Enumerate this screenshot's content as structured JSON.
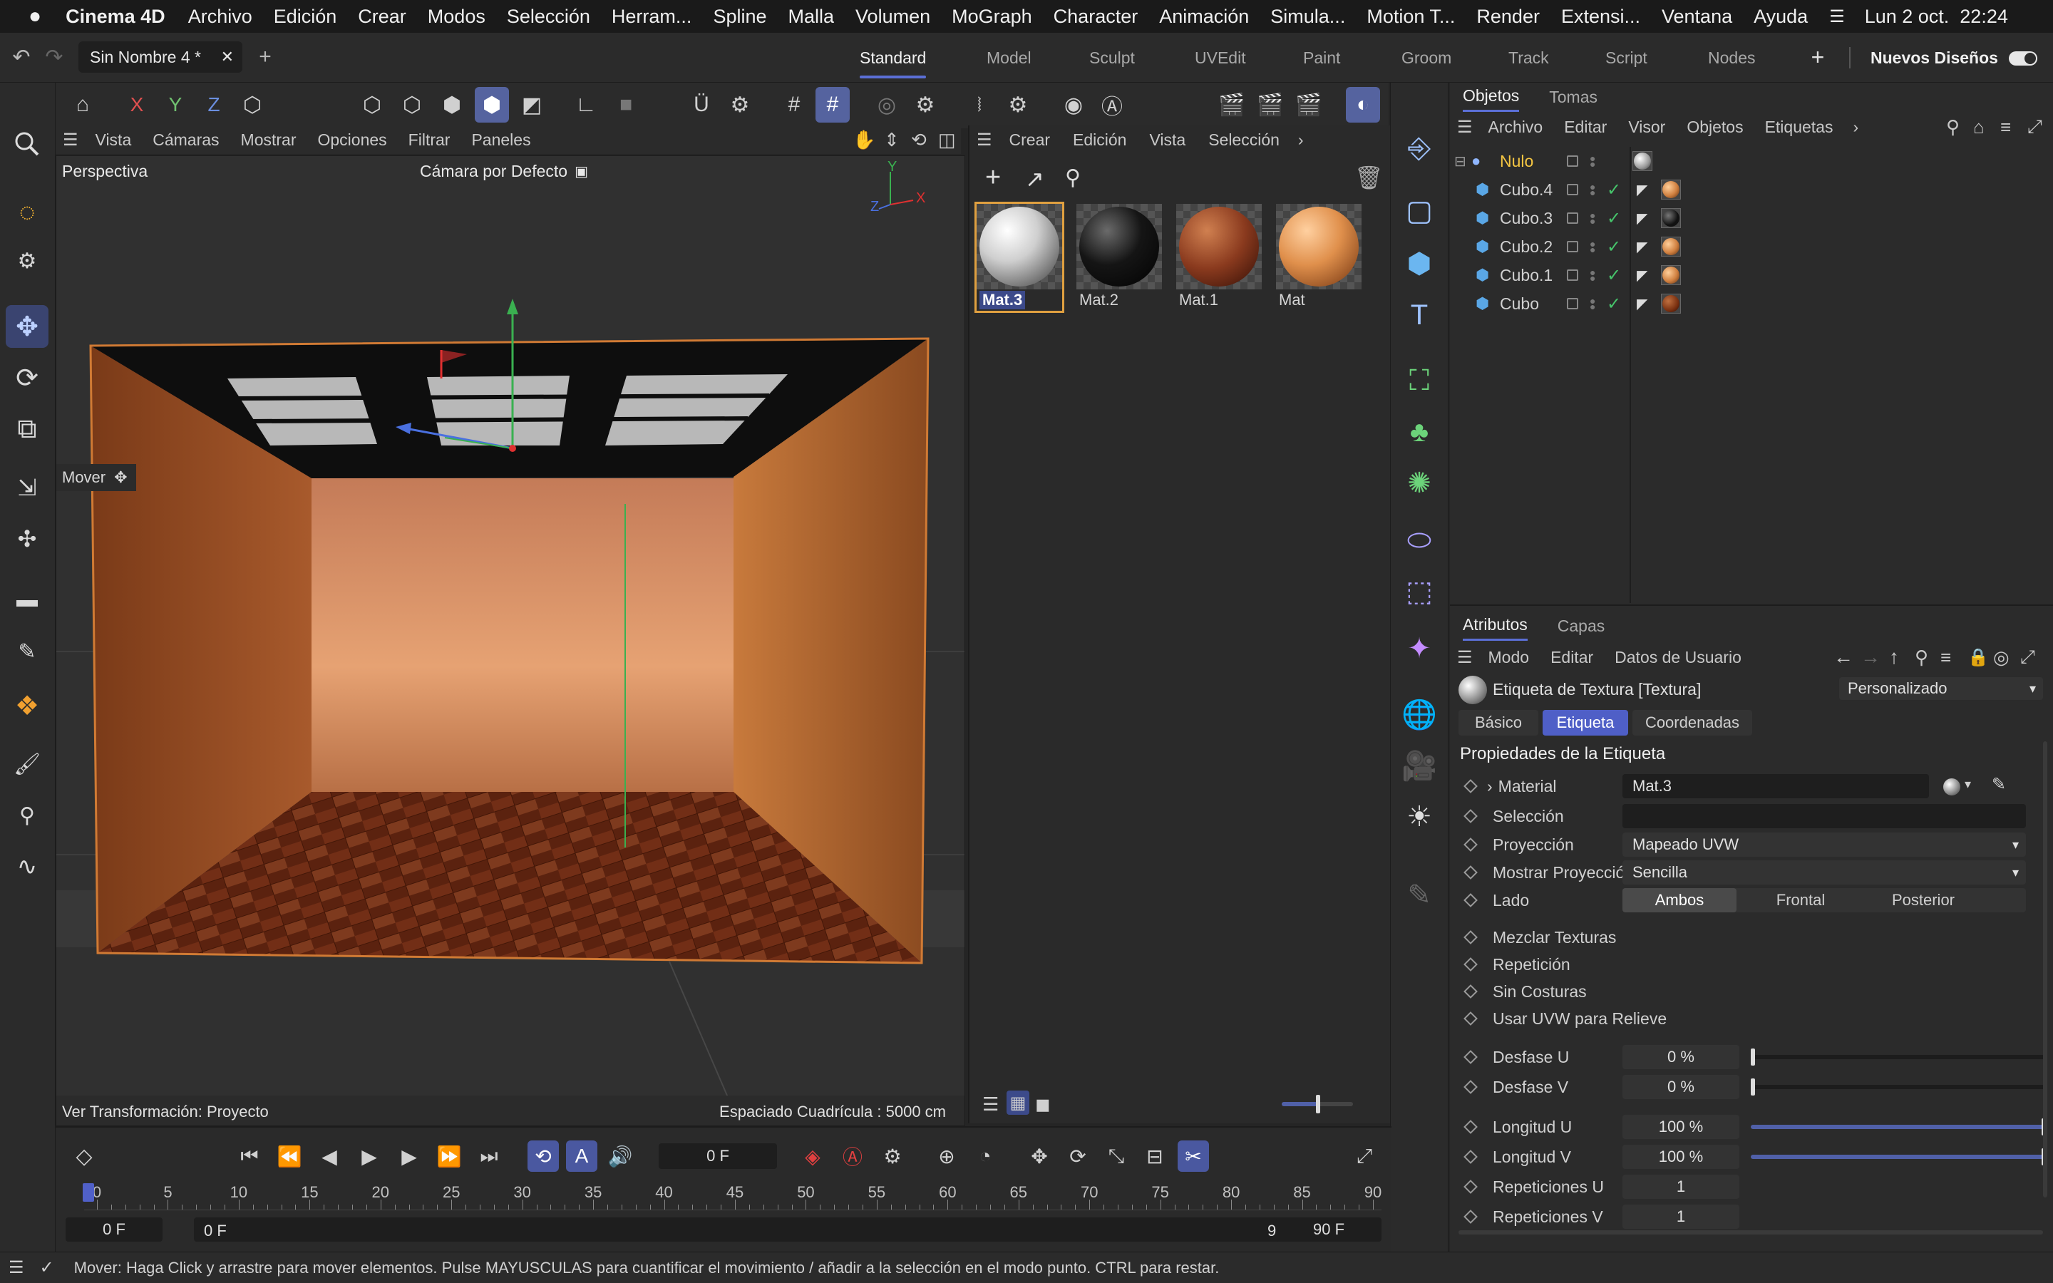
{
  "macmenu": {
    "app": "Cinema 4D",
    "items": [
      "Archivo",
      "Edición",
      "Crear",
      "Modos",
      "Selección",
      "Herram...",
      "Spline",
      "Malla",
      "Volumen",
      "MoGraph",
      "Character",
      "Animación",
      "Simula...",
      "Motion T...",
      "Render",
      "Extensi...",
      "Ventana",
      "Ayuda"
    ],
    "datetime": "Lun 2 oct.  22:24"
  },
  "doc_tab": {
    "title": "Sin Nombre 4 *"
  },
  "layouts": {
    "items": [
      "Standard",
      "Model",
      "Sculpt",
      "UVEdit",
      "Paint",
      "Groom",
      "Track",
      "Script",
      "Nodes"
    ],
    "active": "Standard",
    "new_layouts": "Nuevos Diseños"
  },
  "axis_buttons": {
    "x": "X",
    "y": "Y",
    "z": "Z"
  },
  "viewport": {
    "menu": [
      "Vista",
      "Cámaras",
      "Mostrar",
      "Opciones",
      "Filtrar",
      "Paneles"
    ],
    "name": "Perspectiva",
    "camera": "Cámara por Defecto",
    "tool_label": "Mover",
    "axis_labels": {
      "x": "X",
      "y": "Y",
      "z": "Z"
    },
    "transform_label": "Ver Transformación: Proyecto",
    "grid_label": "Espaciado Cuadrícula : 5000 cm"
  },
  "material_manager": {
    "menu": [
      "Crear",
      "Edición",
      "Vista",
      "Selección"
    ],
    "materials": [
      {
        "name": "Mat.3",
        "kind": "white",
        "selected": true
      },
      {
        "name": "Mat.2",
        "kind": "black",
        "selected": false
      },
      {
        "name": "Mat.1",
        "kind": "wood",
        "selected": false
      },
      {
        "name": "Mat",
        "kind": "orange",
        "selected": false
      }
    ]
  },
  "object_manager": {
    "tabs": [
      "Objetos",
      "Tomas"
    ],
    "menu": [
      "Archivo",
      "Editar",
      "Visor",
      "Objetos",
      "Etiquetas"
    ],
    "objects": [
      {
        "name": "Nulo",
        "type": "null",
        "check": false,
        "tag": "white"
      },
      {
        "name": "Cubo.4",
        "type": "cube",
        "check": true,
        "tag": "orange"
      },
      {
        "name": "Cubo.3",
        "type": "cube",
        "check": true,
        "tag": "black"
      },
      {
        "name": "Cubo.2",
        "type": "cube",
        "check": true,
        "tag": "orange"
      },
      {
        "name": "Cubo.1",
        "type": "cube",
        "check": true,
        "tag": "orange"
      },
      {
        "name": "Cubo",
        "type": "cube",
        "check": true,
        "tag": "wood"
      }
    ]
  },
  "attributes": {
    "tabs": [
      "Atributos",
      "Capas"
    ],
    "menu": [
      "Modo",
      "Editar",
      "Datos de Usuario"
    ],
    "object_title": "Etiqueta de Textura [Textura]",
    "preset": "Personalizado",
    "subtabs": [
      "Básico",
      "Etiqueta",
      "Coordenadas"
    ],
    "active_subtab": "Etiqueta",
    "section": "Propiedades de la Etiqueta",
    "rows": {
      "material": {
        "label": "Material",
        "value": "Mat.3"
      },
      "seleccion": {
        "label": "Selección",
        "value": ""
      },
      "proyeccion": {
        "label": "Proyección",
        "value": "Mapeado UVW"
      },
      "mostrar_proyeccion": {
        "label": "Mostrar Proyección",
        "value": "Sencilla"
      },
      "lado": {
        "label": "Lado",
        "options": [
          "Ambos",
          "Frontal",
          "Posterior"
        ],
        "selected": "Ambos"
      },
      "mezclar": {
        "label": "Mezclar Texturas",
        "checked": false
      },
      "repeticion": {
        "label": "Repetición",
        "checked": true
      },
      "sin_costuras": {
        "label": "Sin Costuras",
        "checked": false
      },
      "usar_uvw": {
        "label": "Usar UVW para Relieve",
        "checked": true
      },
      "desfase_u": {
        "label": "Desfase U",
        "value": "0 %",
        "fraction": 0.0
      },
      "desfase_v": {
        "label": "Desfase V",
        "value": "0 %",
        "fraction": 0.0
      },
      "longitud_u": {
        "label": "Longitud U",
        "value": "100 %",
        "fraction": 1.0
      },
      "longitud_v": {
        "label": "Longitud V",
        "value": "100 %",
        "fraction": 1.0
      },
      "repeticiones_u": {
        "label": "Repeticiones U",
        "value": "1"
      },
      "repeticiones_v": {
        "label": "Repeticiones V",
        "value": "1"
      }
    }
  },
  "timeline": {
    "current_frame": "0 F",
    "ticks": [
      "0",
      "5",
      "10",
      "15",
      "20",
      "25",
      "30",
      "35",
      "40",
      "45",
      "50",
      "55",
      "60",
      "65",
      "70",
      "75",
      "80",
      "85",
      "90"
    ],
    "range_start": "0 F",
    "range_start2": "0 F",
    "range_end": "90 F",
    "range_end2": "90 F"
  },
  "status": {
    "text": "Mover: Haga Click y arrastre para mover elementos. Pulse MAYUSCULAS para cuantificar el movimiento / añadir a la selección en el modo punto. CTRL para restar."
  },
  "colors": {
    "accent": "#5b6fd6",
    "selection": "#4f5fc7",
    "null_name": "#f4c542",
    "cube_icon": "#5aa7e6",
    "check_green": "#46c46b"
  }
}
